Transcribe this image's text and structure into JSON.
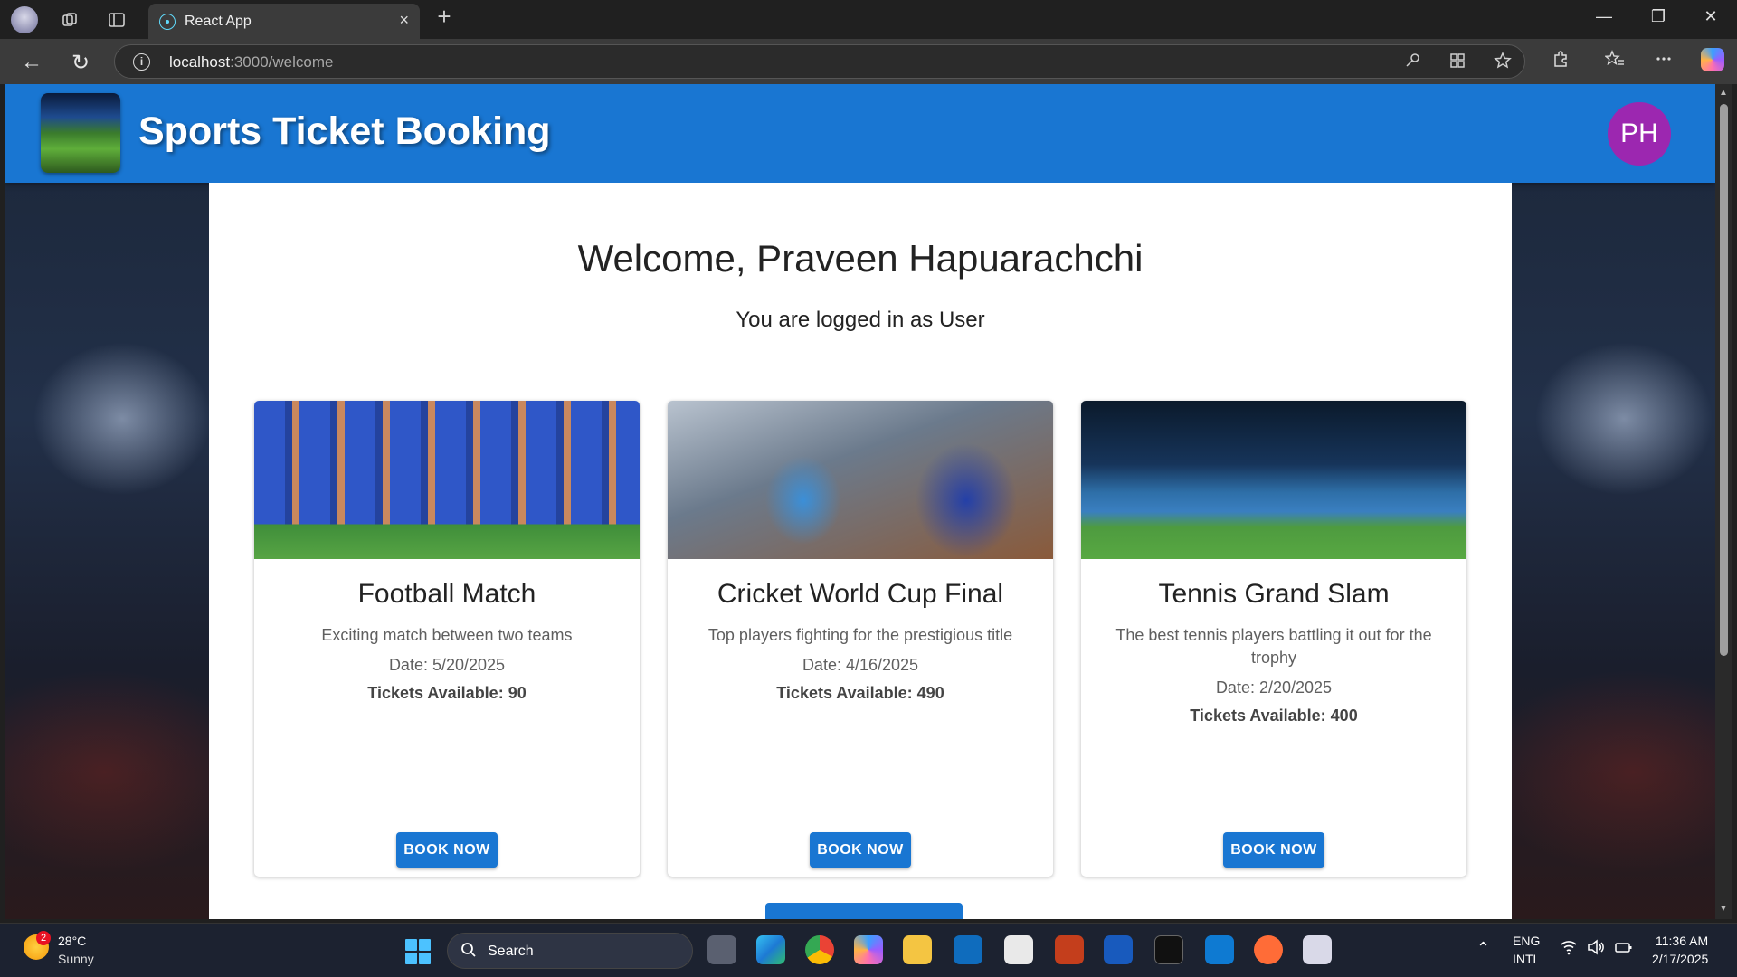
{
  "browser": {
    "tab_title": "React App",
    "url_host": "localhost",
    "url_path": ":3000/welcome",
    "close_tab_glyph": "×",
    "new_tab_glyph": "+",
    "minimize_glyph": "—",
    "restore_glyph": "❐",
    "close_glyph": "✕",
    "back_glyph": "←",
    "refresh_glyph": "↻",
    "info_glyph": "i",
    "omnibox_icons": [
      "key-icon",
      "grid-icon",
      "star-icon"
    ],
    "toolbar_icons": [
      "extensions-icon",
      "favorites-icon",
      "more-icon",
      "copilot-icon"
    ]
  },
  "header": {
    "title": "Sports Ticket Booking",
    "avatar_initials": "PH",
    "colors": {
      "bar": "#1976d2",
      "avatar": "#9c27b0"
    }
  },
  "welcome": {
    "heading": "Welcome, Praveen Hapuarachchi",
    "role_line": "You are logged in as User"
  },
  "events": [
    {
      "title": "Football Match",
      "description": "Exciting match between two teams",
      "date": "Date: 5/20/2025",
      "tickets": "Tickets Available: 90",
      "button": "BOOK NOW"
    },
    {
      "title": "Cricket World Cup Final",
      "description": "Top players fighting for the prestigious title",
      "date": "Date: 4/16/2025",
      "tickets": "Tickets Available: 490",
      "button": "BOOK NOW"
    },
    {
      "title": "Tennis Grand Slam",
      "description": "The best tennis players battling it out for the trophy",
      "date": "Date: 2/20/2025",
      "tickets": "Tickets Available: 400",
      "button": "BOOK NOW"
    }
  ],
  "taskbar": {
    "weather_badge": "2",
    "temperature": "28°C",
    "condition": "Sunny",
    "search_label": "Search",
    "language": "ENG",
    "layout": "INTL",
    "time": "11:36 AM",
    "date": "2/17/2025",
    "apps": [
      "task-view",
      "edge",
      "chrome",
      "copilot",
      "file-explorer",
      "outlook",
      "photos",
      "powerpoint",
      "word",
      "terminal",
      "vscode",
      "postman",
      "snipping-tool"
    ]
  }
}
